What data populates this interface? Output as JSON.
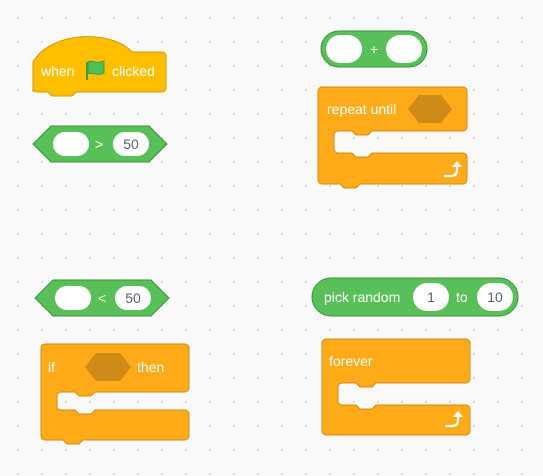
{
  "colors": {
    "events": "#FFBF00",
    "events_border": "#CC9900",
    "control": "#FFAB19",
    "control_border": "#CF8B17",
    "operators": "#59C059",
    "operators_border": "#389438",
    "boolean_slot": "#CF8B17",
    "flag": "#4CBF56",
    "workspace": "#F9F9F9"
  },
  "blocks": {
    "when_flag": {
      "label_when": "when",
      "label_clicked": "clicked",
      "icon": "green-flag-icon"
    },
    "gt": {
      "operator": ">",
      "right_value": "50"
    },
    "add": {
      "operator": "+"
    },
    "repeat_until": {
      "label": "repeat until",
      "icon": "loop-arrow-icon"
    },
    "lt": {
      "operator": "<",
      "right_value": "50"
    },
    "if_then": {
      "label_if": "if",
      "label_then": "then"
    },
    "pick_random": {
      "label": "pick random",
      "from_value": "1",
      "to_label": "to",
      "to_value": "10"
    },
    "forever": {
      "label": "forever",
      "icon": "loop-arrow-icon"
    }
  }
}
